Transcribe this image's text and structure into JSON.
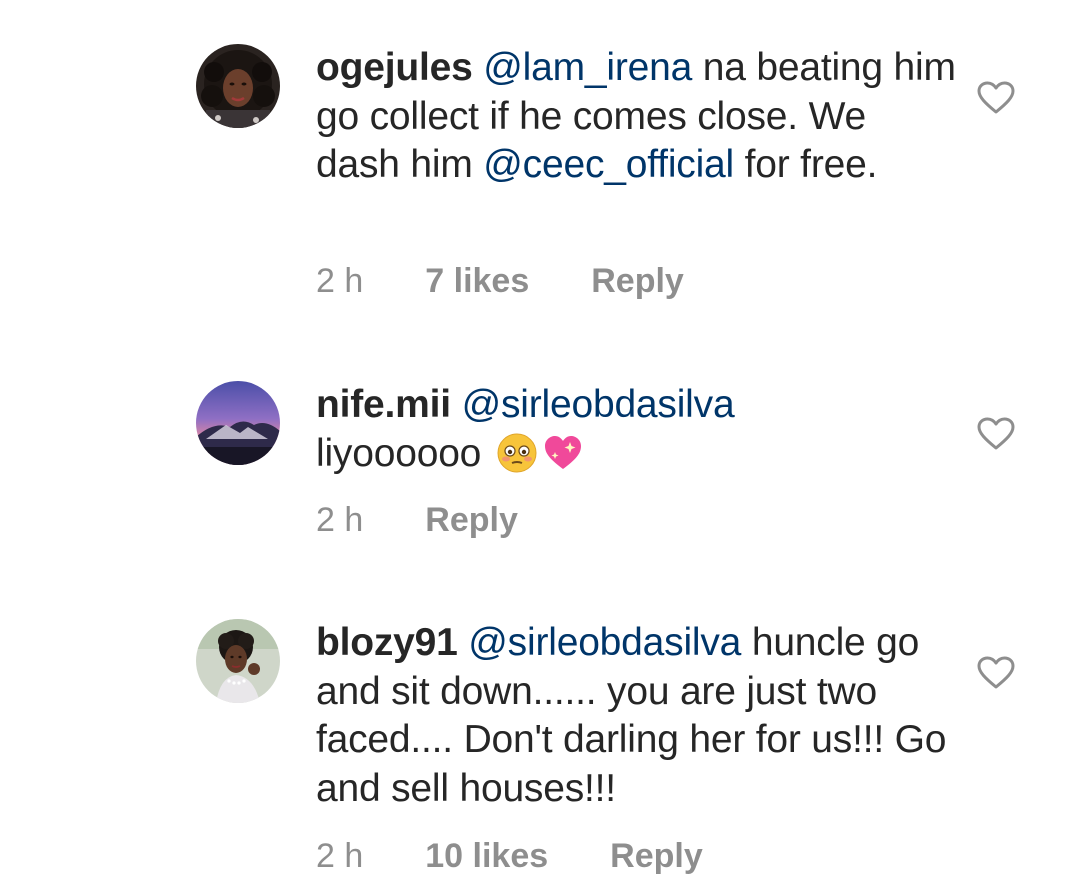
{
  "comments": [
    {
      "username": "ogejules",
      "mention1": "@lam_irena",
      "text1": " na beating him go collect  if he comes close. We dash him ",
      "mention2": "@ceec_official",
      "text2": "  for free.",
      "time": "2 h",
      "likes": "7 likes",
      "reply": "Reply",
      "avatar": "avatar-woman-curly-hair"
    },
    {
      "username": "nife.mii",
      "mention1": "@sirleobdasilva",
      "text1": " liyoooooo ",
      "emojis": [
        "flushed-face-emoji",
        "sparkling-heart-emoji"
      ],
      "time": "2 h",
      "reply": "Reply",
      "avatar": "avatar-mountain-sunset"
    },
    {
      "username": "blozy91",
      "mention1": "@sirleobdasilva",
      "text1": " huncle go and sit down...... you are just two faced.... Don't darling her for us!!! Go and sell houses!!!",
      "time": "2 h",
      "likes": "10 likes",
      "reply": "Reply",
      "avatar": "avatar-woman-short-hair"
    }
  ],
  "colors": {
    "text": "#262626",
    "mention": "#003569",
    "meta": "#8e8e8e",
    "heart_outline": "#8e8e8e"
  },
  "icons": {
    "like": "heart-outline-icon"
  }
}
